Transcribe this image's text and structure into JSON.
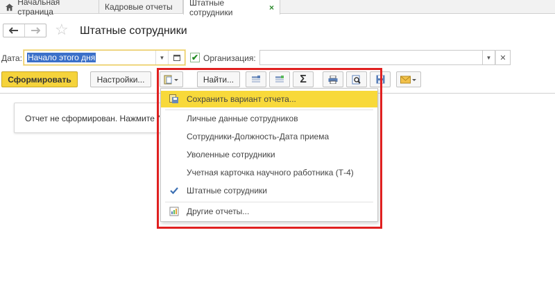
{
  "tabs": [
    {
      "label": "Начальная страница",
      "icon": "home-icon"
    },
    {
      "label": "Кадровые отчеты"
    },
    {
      "label": "Штатные сотрудники",
      "close": "×"
    }
  ],
  "header": {
    "title": "Штатные сотрудники"
  },
  "params": {
    "date_label": "Дата:",
    "date_value": "Начало этого дня",
    "org_label": "Организация:",
    "org_value": ""
  },
  "toolbar": {
    "generate_label": "Сформировать",
    "settings_label": "Настройки...",
    "find_label": "Найти..."
  },
  "content": {
    "message": "Отчет не сформирован. Нажмите \"С"
  },
  "menu": {
    "items": [
      {
        "label": "Сохранить вариант отчета...",
        "highlighted": true,
        "icon": "save-variant-icon"
      },
      {
        "label": "Личные данные сотрудников"
      },
      {
        "label": "Сотрудники-Должность-Дата приема"
      },
      {
        "label": "Уволенные сотрудники"
      },
      {
        "label": "Учетная карточка научного работника (Т-4)"
      },
      {
        "label": "Штатные сотрудники",
        "checked": true
      },
      {
        "label": "Другие отчеты...",
        "icon": "other-reports-icon"
      }
    ]
  },
  "colors": {
    "accent_yellow": "#f5d33b",
    "highlight_box": "#e02020",
    "check_green": "#1f8a1f"
  }
}
